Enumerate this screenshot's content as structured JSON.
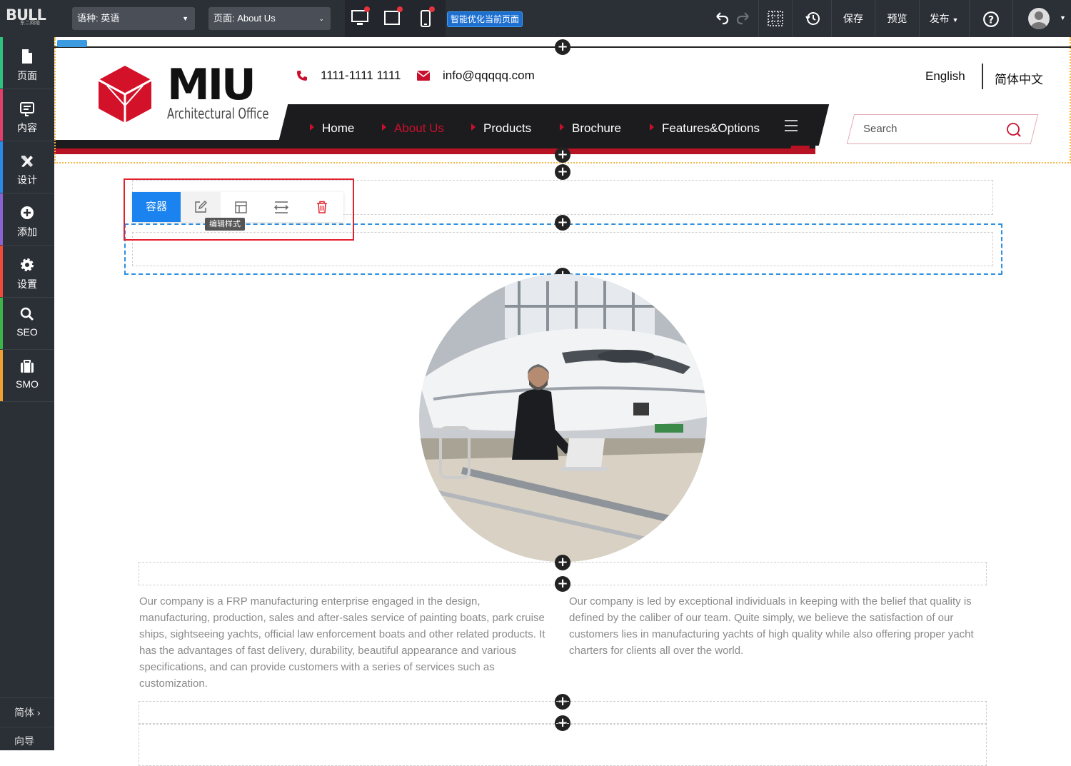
{
  "topbar": {
    "logo_text": "BULL",
    "logo_sub": "东二网络",
    "language_select": "语种: 英语",
    "page_select": "页面: About Us",
    "optimize_button": "智能优化当前页面",
    "save": "保存",
    "preview": "预览",
    "publish": "发布"
  },
  "sidebar": {
    "items": [
      {
        "label": "页面",
        "icon": "page-icon",
        "color": "#2ec27e"
      },
      {
        "label": "内容",
        "icon": "content-icon",
        "color": "#e03e6b"
      },
      {
        "label": "设计",
        "icon": "design-icon",
        "color": "#2a8be6"
      },
      {
        "label": "添加",
        "icon": "add-icon",
        "color": "#8a63d2"
      },
      {
        "label": "设置",
        "icon": "settings-icon",
        "color": "#f04a3b"
      },
      {
        "label": "SEO",
        "icon": "seo-icon",
        "color": "#3bb54a"
      },
      {
        "label": "SMO",
        "icon": "smo-icon",
        "color": "#f0a033"
      }
    ],
    "lang": "简体 ›",
    "guide": "向导"
  },
  "site": {
    "brand": "MIU",
    "brand_sub": "Architectural Office",
    "phone": "1111-1111 1111",
    "email": "info@qqqqq.com",
    "lang_en": "English",
    "lang_cn": "简体中文",
    "nav": [
      "Home",
      "About Us",
      "Products",
      "Brochure",
      "Features&Options"
    ],
    "search_placeholder": "Search",
    "accent": "#c8102e"
  },
  "editor": {
    "container_button": "容器",
    "tooltip": "编辑样式"
  },
  "content": {
    "para_left": "Our company is a FRP manufacturing enterprise engaged in the design, manufacturing, production, sales and after-sales service of painting boats, park cruise ships, sightseeing yachts, official law enforcement boats and other related products. It has the advantages of fast delivery, durability, beautiful appearance and various specifications, and can provide customers with a series of services such as customization.",
    "para_right": "Our company is led by exceptional individuals in keeping with the belief that quality is defined by the caliber of our team. Quite simply, we believe the satisfaction of our customers lies in manufacturing yachts of high quality while also offering proper yacht charters for clients all over the world."
  }
}
